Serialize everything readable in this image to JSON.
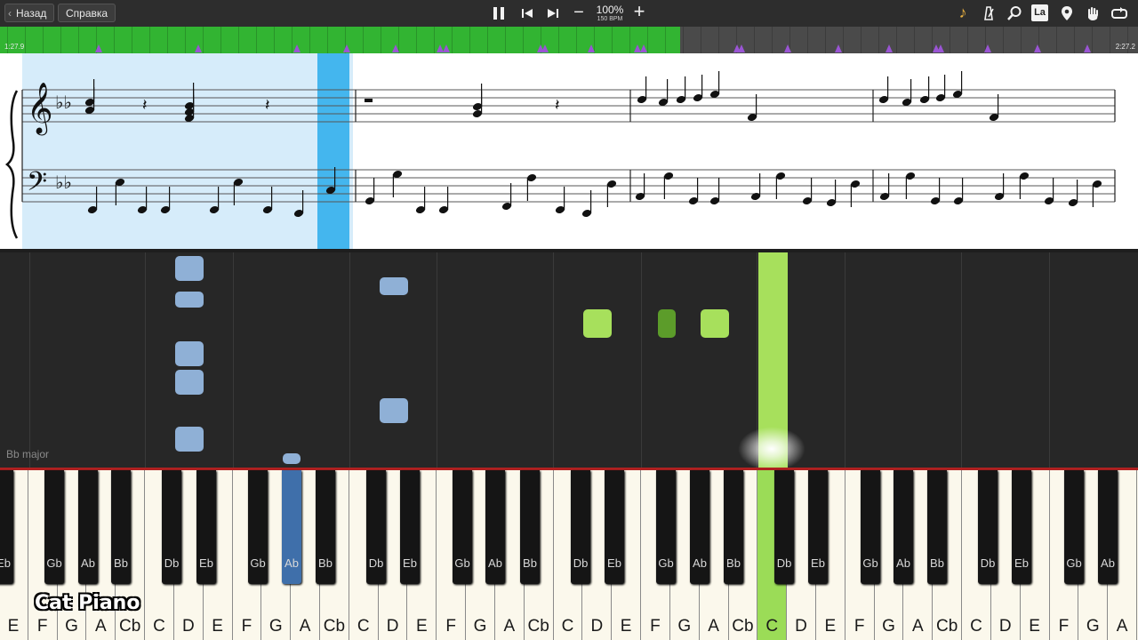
{
  "toolbar": {
    "back_label": "Назад",
    "help_label": "Справка",
    "zoom": "100%",
    "tempo": "150 BPM",
    "left_icons": [
      "pause-icon",
      "skip-back-icon",
      "play-forward-icon"
    ],
    "right_icons": [
      "music-note-icon",
      "metronome-icon",
      "search-icon",
      "note-labels-icon",
      "pin-icon",
      "hand-icon",
      "loop-icon"
    ],
    "note_labels_icon_text": "La"
  },
  "timeline": {
    "start_time": "1:27.9",
    "end_time": "2:27.2",
    "progress": 0.598,
    "progress_color": "#32b432",
    "marker_color": "#9a55d4"
  },
  "score": {
    "treble_clef": "𝄞",
    "bass_clef": "𝄢",
    "key_signature": "♭♭"
  },
  "piano_roll": {
    "key_label": "Bb major",
    "note_color_blue": "#8fb0d6",
    "note_color_green": "#a7e05c",
    "note_color_dark_green": "#5c9c2a"
  },
  "keyboard": {
    "white_keys": [
      "E",
      "F",
      "G",
      "A",
      "Cb",
      "C",
      "D",
      "E",
      "F",
      "G",
      "A",
      "Cb",
      "C",
      "D",
      "E",
      "F",
      "G",
      "A",
      "Cb",
      "C",
      "D",
      "E",
      "F",
      "G",
      "A",
      "Cb",
      "C",
      "D",
      "E",
      "F",
      "G",
      "A",
      "Cb",
      "C",
      "D",
      "E",
      "F",
      "G",
      "A",
      "Cb",
      "C",
      "D",
      "E",
      "F",
      "G",
      "A"
    ],
    "black_keys": [
      "Eb",
      "Gb",
      "Ab",
      "Bb",
      "Db",
      "Eb",
      "Gb",
      "Ab",
      "Bb",
      "Db",
      "Eb",
      "Gb",
      "Ab",
      "Bb",
      "Db",
      "Eb",
      "Gb",
      "Ab",
      "Bb",
      "Db",
      "Eb",
      "Gb",
      "Ab",
      "Bb",
      "Db",
      "Eb",
      "Gb",
      "Ab",
      "Bb",
      "Db",
      "Eb",
      "Gb",
      "Ab",
      "Bb"
    ],
    "pressed_white_key": "C",
    "pressed_black_key": "Ab",
    "pressed_white_color": "#9bdc57",
    "pressed_black_color": "#3f6faa"
  },
  "logo": "Cat Piano"
}
